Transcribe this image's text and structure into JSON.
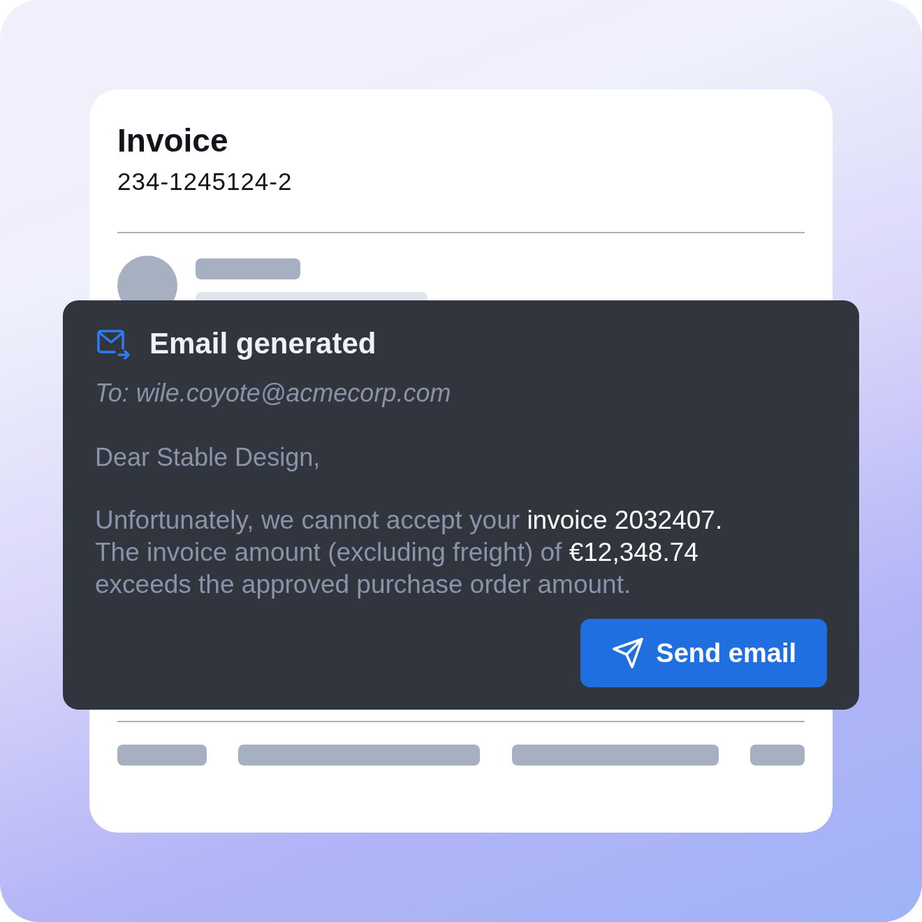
{
  "invoice": {
    "title": "Invoice",
    "number": "234-1245124-2"
  },
  "email": {
    "title": "Email generated",
    "to": "To: wile.coyote@acmecorp.com",
    "greeting": "Dear Stable Design,",
    "body": [
      {
        "text": "Unfortunately, we cannot accept your ",
        "emphasis": false
      },
      {
        "text": "invoice 2032407.",
        "emphasis": true
      },
      {
        "text": " The invoice amount (excluding freight) of ",
        "emphasis": false
      },
      {
        "text": "€12,348.74",
        "emphasis": true
      },
      {
        "text": " exceeds the approved purchase order amount.",
        "emphasis": false
      }
    ],
    "button": "Send email"
  }
}
